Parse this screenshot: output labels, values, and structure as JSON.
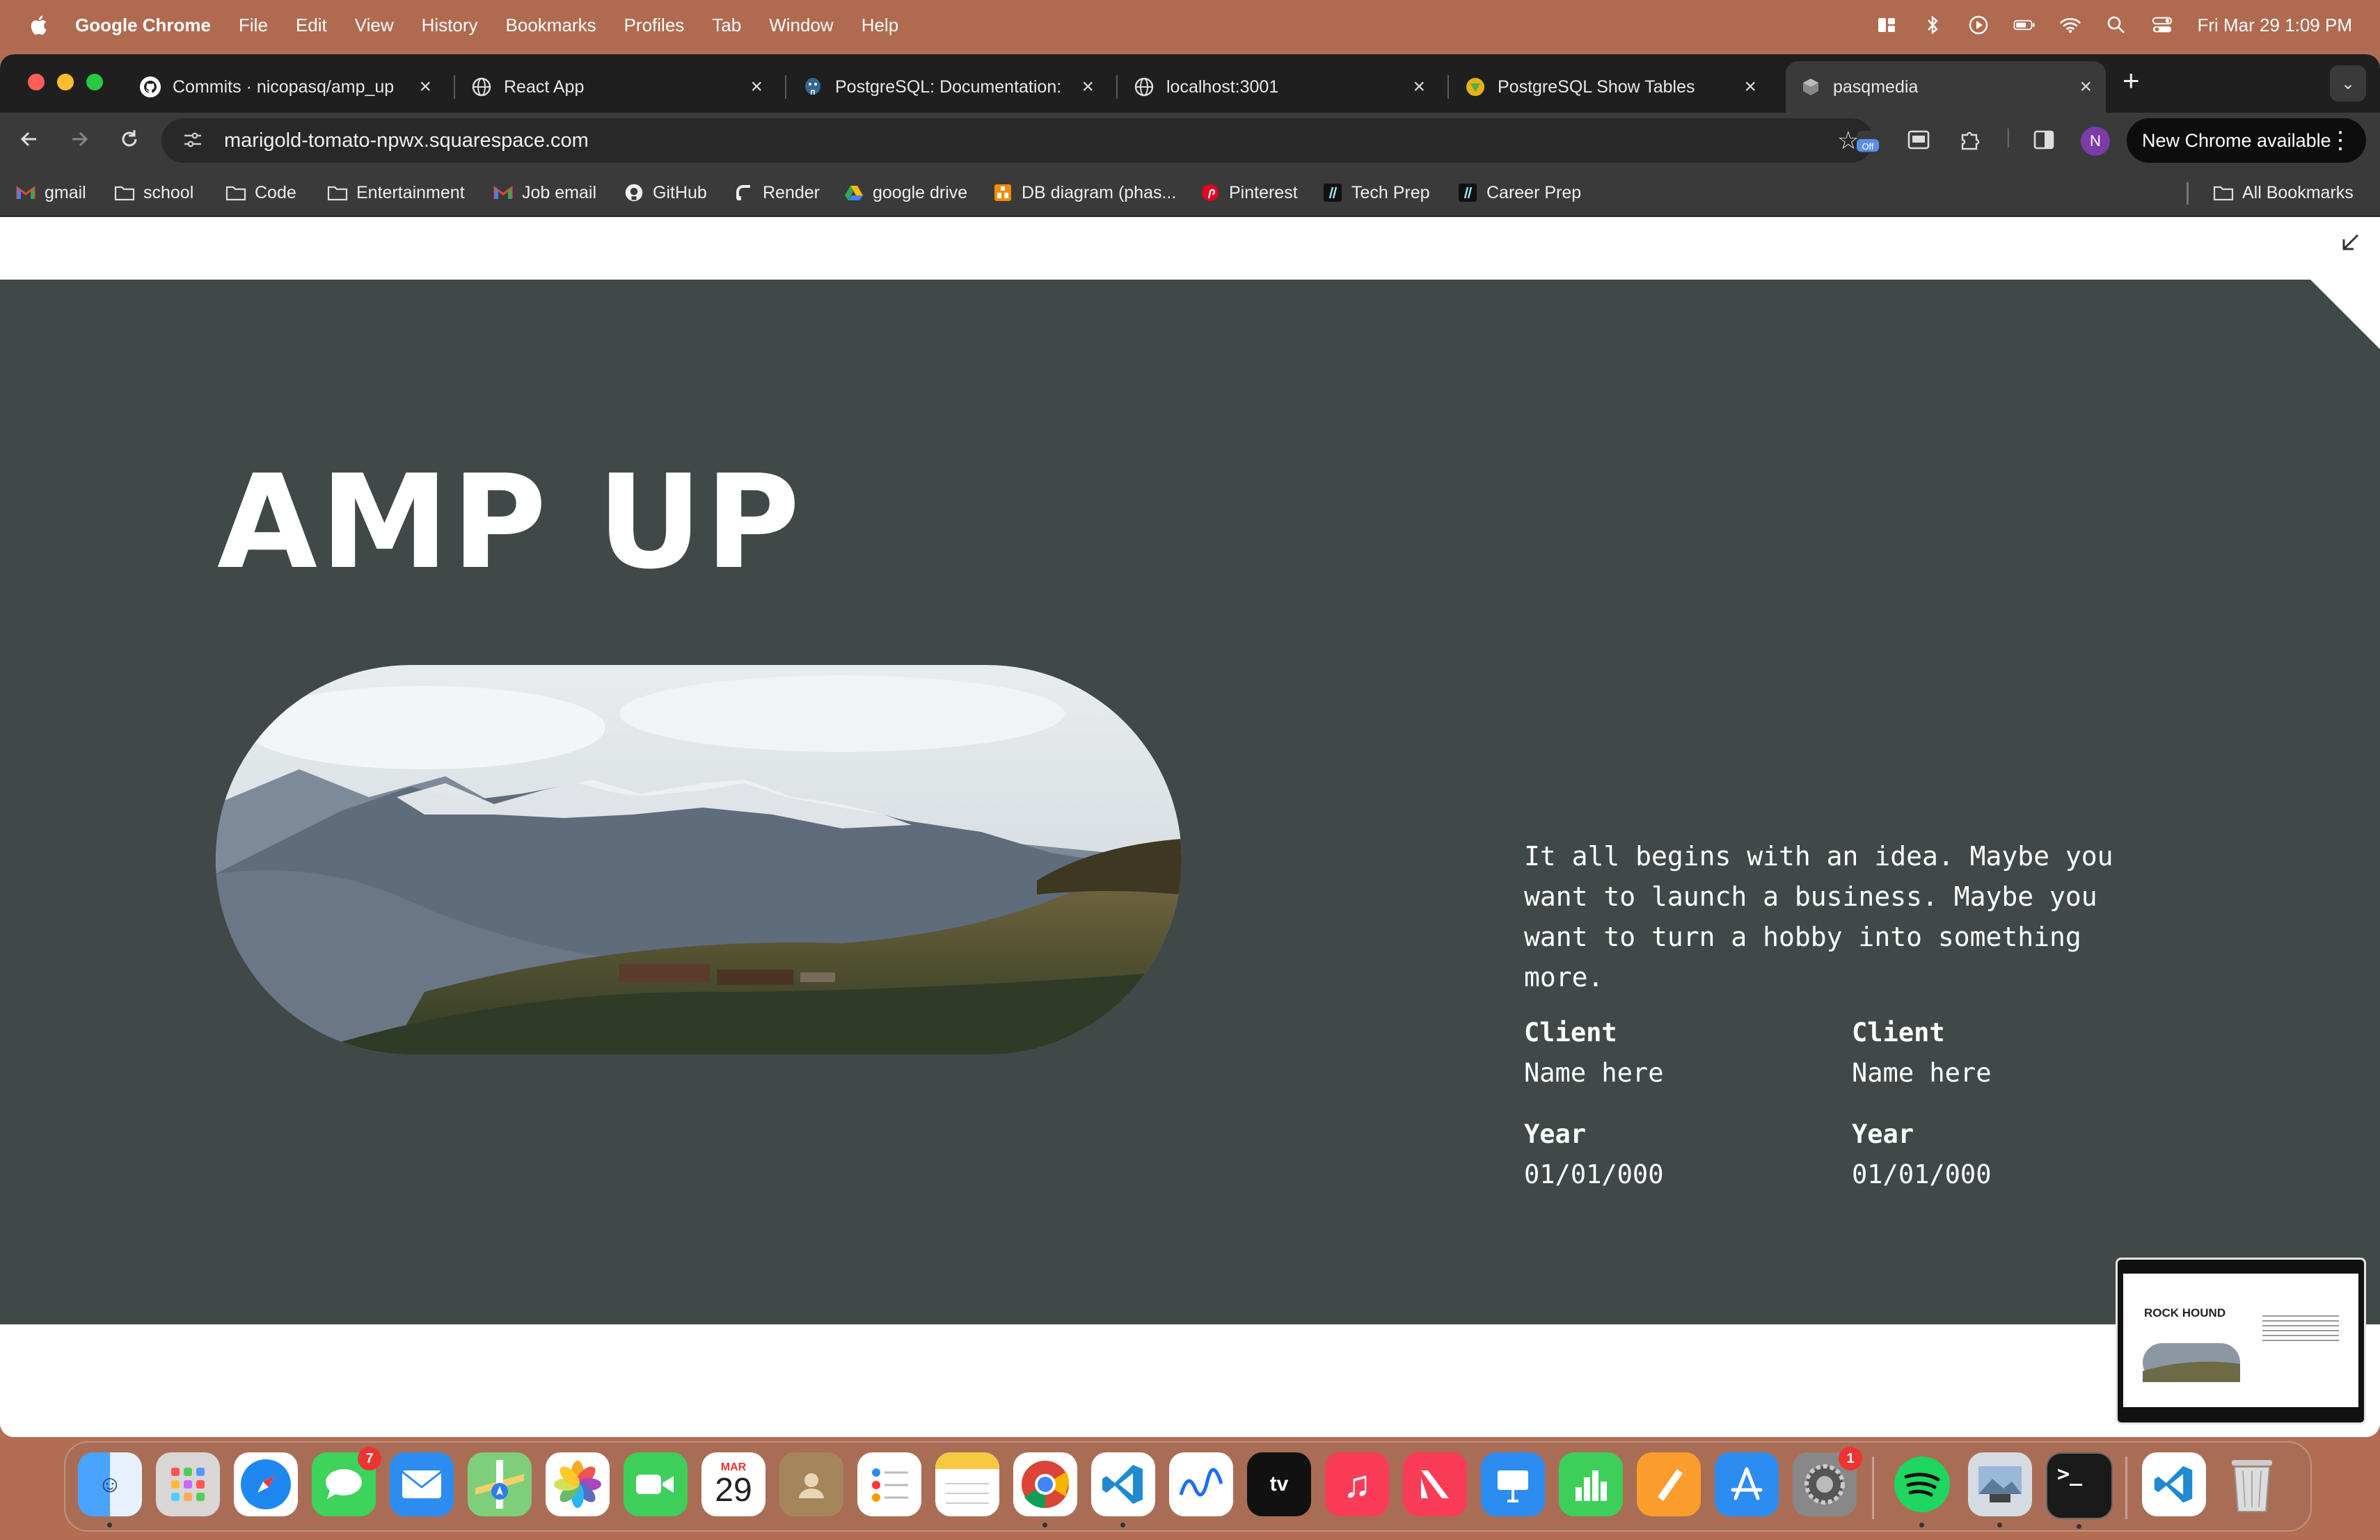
{
  "menubar": {
    "app_name": "Google Chrome",
    "menus": [
      "File",
      "Edit",
      "View",
      "History",
      "Bookmarks",
      "Profiles",
      "Tab",
      "Window",
      "Help"
    ],
    "clock": "Fri Mar 29  1:09 PM",
    "status_icons": [
      "stage-manager-icon",
      "bluetooth-icon",
      "play-icon",
      "battery-icon",
      "wifi-icon",
      "spotlight-icon",
      "control-center-icon"
    ]
  },
  "tabs": [
    {
      "title": "Commits · nicopasq/amp_up",
      "icon": "github-icon"
    },
    {
      "title": "React App",
      "icon": "globe-icon"
    },
    {
      "title": "PostgreSQL: Documentation:",
      "icon": "postgres-icon"
    },
    {
      "title": "localhost:3001",
      "icon": "globe-icon"
    },
    {
      "title": "PostgreSQL Show Tables",
      "icon": "neon-icon"
    },
    {
      "title": "pasqmedia",
      "icon": "squarespace-icon",
      "active": true
    }
  ],
  "toolbar": {
    "url": "marigold-tomato-npwx.squarespace.com",
    "ext_badge": "Off",
    "profile_initial": "N",
    "update_label": "New Chrome available"
  },
  "bookmarks": [
    {
      "label": "gmail",
      "icon": "gmail-icon"
    },
    {
      "label": "school",
      "icon": "folder-icon"
    },
    {
      "label": "Code",
      "icon": "folder-icon"
    },
    {
      "label": "Entertainment",
      "icon": "folder-icon"
    },
    {
      "label": "Job email",
      "icon": "gmail-icon"
    },
    {
      "label": "GitHub",
      "icon": "github-icon"
    },
    {
      "label": "Render",
      "icon": "render-icon"
    },
    {
      "label": "google drive",
      "icon": "drive-icon"
    },
    {
      "label": "DB diagram (phas...",
      "icon": "dbdiagram-icon"
    },
    {
      "label": "Pinterest",
      "icon": "pinterest-icon"
    },
    {
      "label": "Tech Prep",
      "icon": "slash-icon"
    },
    {
      "label": "Career Prep",
      "icon": "slash-icon"
    }
  ],
  "all_bookmarks": "All Bookmarks",
  "page": {
    "title": "AMP UP",
    "description": "It all begins with an idea. Maybe you want to launch a business. Maybe you want to turn a hobby into something more.",
    "meta": [
      {
        "label": "Client",
        "value": "Name here"
      },
      {
        "label": "Client",
        "value": "Name here"
      },
      {
        "label": "Year",
        "value": "01/01/000"
      },
      {
        "label": "Year",
        "value": "01/01/000"
      }
    ]
  },
  "pip": {
    "title": "ROCK HOUND"
  },
  "dock": {
    "apps": [
      "Finder",
      "Launchpad",
      "Safari",
      "Messages",
      "Mail",
      "Maps",
      "Photos",
      "FaceTime",
      "Calendar",
      "Contacts",
      "Reminders",
      "Notes",
      "Chrome",
      "VS Code",
      "Freeform",
      "TV",
      "Music",
      "News",
      "Keynote",
      "Numbers",
      "Pages",
      "App Store",
      "System Settings",
      "Spotify",
      "Preview",
      "Terminal",
      "VS Code",
      "Trash"
    ],
    "messages_badge": "7",
    "settings_badge": "1",
    "calendar_month": "MAR",
    "calendar_day": "29"
  }
}
